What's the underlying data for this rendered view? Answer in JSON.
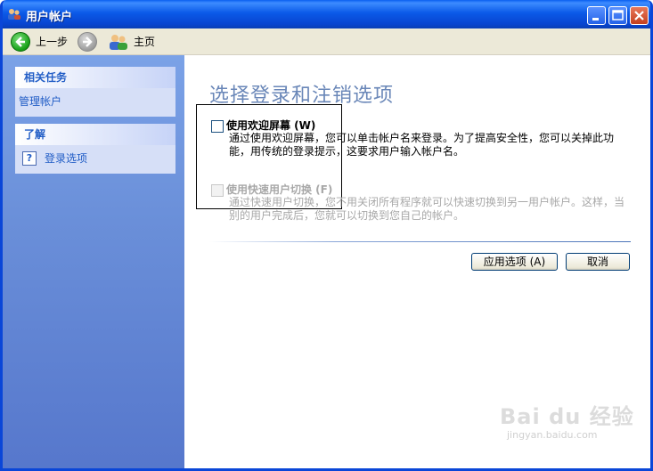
{
  "window": {
    "title": "用户帐户"
  },
  "toolbar": {
    "back_label": "上一步",
    "home_label": "主页"
  },
  "sidebar": {
    "tasks": {
      "header": "相关任务",
      "items": [
        "管理帐户"
      ]
    },
    "learn": {
      "header": "了解",
      "items": [
        "登录选项"
      ]
    }
  },
  "main": {
    "heading": "选择登录和注销选项",
    "options": [
      {
        "label": "使用欢迎屏幕 (W)",
        "checked": false,
        "enabled": true,
        "desc1": "通过使用欢迎屏幕，您可以单击帐户名来登录。为了提高安全性，您可以关掉此功",
        "desc2": "能，用传统的登录提示，这要求用户输入帐户名。"
      },
      {
        "label": "使用快速用户切换 (F)",
        "checked": false,
        "enabled": false,
        "desc1": "通过快速用户切换，您不用关闭所有程序就可以快速切换到另一用户帐户。这样，当",
        "desc2": "别的用户完成后，您就可以切换到您自己的帐户。"
      }
    ],
    "apply_label": "应用选项 (A)",
    "cancel_label": "取消"
  },
  "watermark": {
    "logo": "Bai du 经验",
    "sub": "jingyan.baidu.com"
  },
  "colors": {
    "title_bar": "#0a5ae8",
    "sidebar": "#6a8fd9",
    "link": "#215dc6",
    "heading": "#6a87b8"
  }
}
